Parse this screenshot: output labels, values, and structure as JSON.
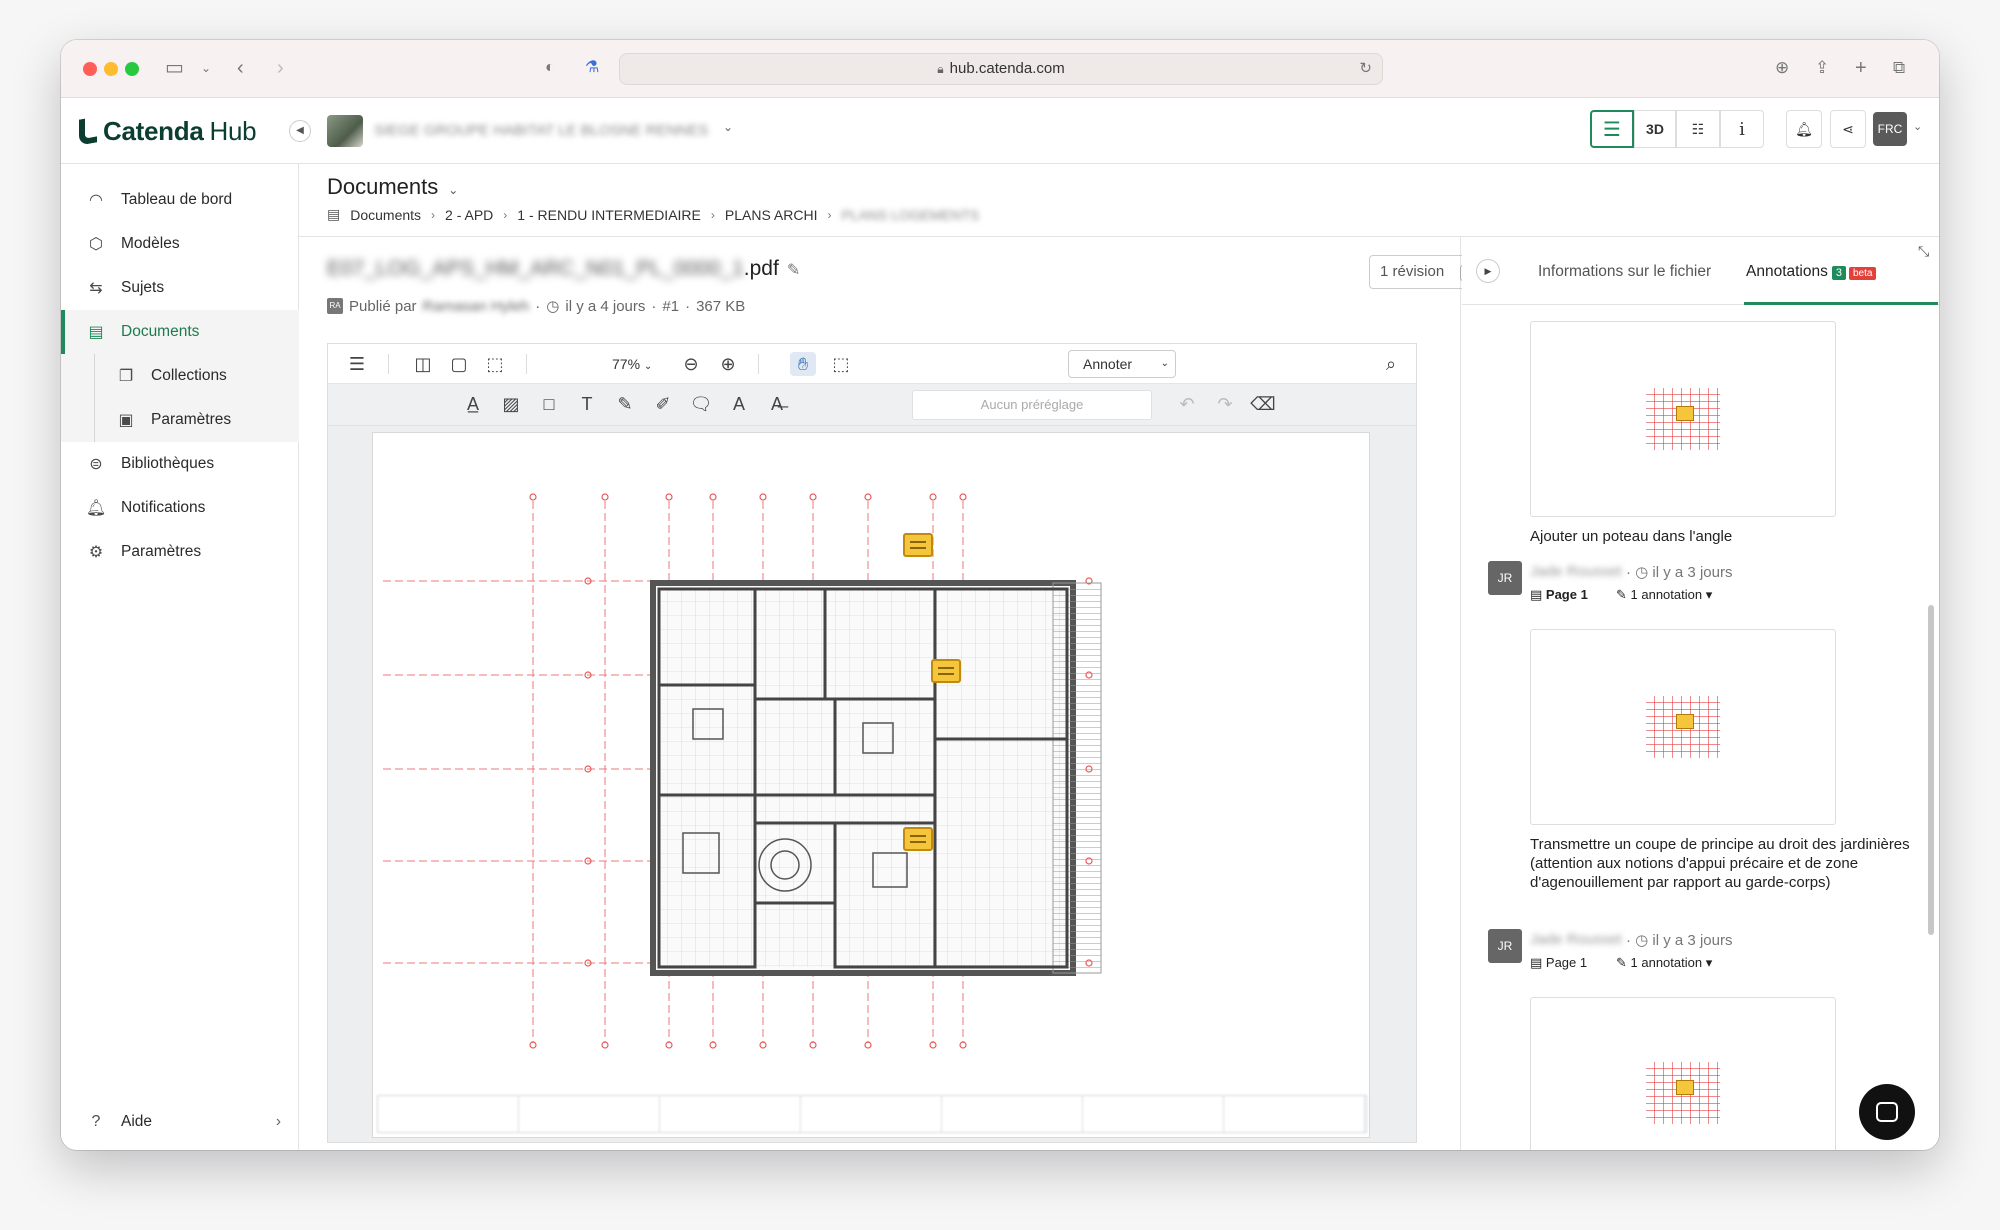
{
  "browser": {
    "url": "hub.catenda.com"
  },
  "app": {
    "brand_name": "Catenda",
    "brand_suffix": "Hub",
    "project_name": "SIEGE GROUPE HABITAT LE BLOSNE RENNES"
  },
  "top_views": {
    "list_label": "",
    "three_d_label": "3D",
    "user_initials": "FRC"
  },
  "sidebar": {
    "items": [
      {
        "label": "Tableau de bord",
        "icon": "dashboard-icon"
      },
      {
        "label": "Modèles",
        "icon": "cube-icon"
      },
      {
        "label": "Sujets",
        "icon": "topics-icon"
      },
      {
        "label": "Documents",
        "icon": "archive-icon"
      },
      {
        "label": "Collections",
        "icon": "collections-icon"
      },
      {
        "label": "Paramètres",
        "icon": "doc-settings-icon"
      },
      {
        "label": "Bibliothèques",
        "icon": "library-icon"
      },
      {
        "label": "Notifications",
        "icon": "bell-icon"
      },
      {
        "label": "Paramètres",
        "icon": "gear-icon"
      }
    ],
    "help_label": "Aide"
  },
  "header": {
    "title": "Documents",
    "breadcrumb": [
      "Documents",
      "2 - APD",
      "1 - RENDU INTERMEDIAIRE",
      "PLANS ARCHI",
      "PLANS LOGEMENTS"
    ]
  },
  "file": {
    "name_blurred": "E07_LOG_APS_HM_ARC_N01_PL_0000_1",
    "extension": ".pdf",
    "published_by_label": "Publié par",
    "author_blurred": "Ramasan Hyleh",
    "published_time": "il y a 4 jours",
    "revision_number": "#1",
    "size": "367 KB",
    "revision_button": "1 révision",
    "author_initials": "RA"
  },
  "viewer": {
    "zoom": "77%",
    "annotate_mode": "Annoter",
    "preset_placeholder": "Aucun préréglage"
  },
  "right_panel": {
    "tab_info": "Informations sur le fichier",
    "tab_annotations": "Annotations",
    "annotation_count": "3",
    "beta": "beta",
    "annotations": [
      {
        "text": "Ajouter un poteau dans l'angle",
        "initials": "JR",
        "author_blurred": "Jade Rousset",
        "time": "il y a 3 jours",
        "page": "Page 1",
        "count": "1 annotation"
      },
      {
        "text": "Transmettre un coupe de principe au droit des jardinières (attention aux notions d'appui précaire et de zone d'agenouillement par rapport au garde-corps)",
        "initials": "JR",
        "author_blurred": "Jade Rousset",
        "time": "il y a 3 jours",
        "page": "Page 1",
        "count": "1 annotation"
      },
      {
        "text": ""
      }
    ]
  },
  "colors": {
    "accent": "#1f8a5a",
    "beta": "#e2413b",
    "annotation_yellow": "#f5c63c"
  }
}
